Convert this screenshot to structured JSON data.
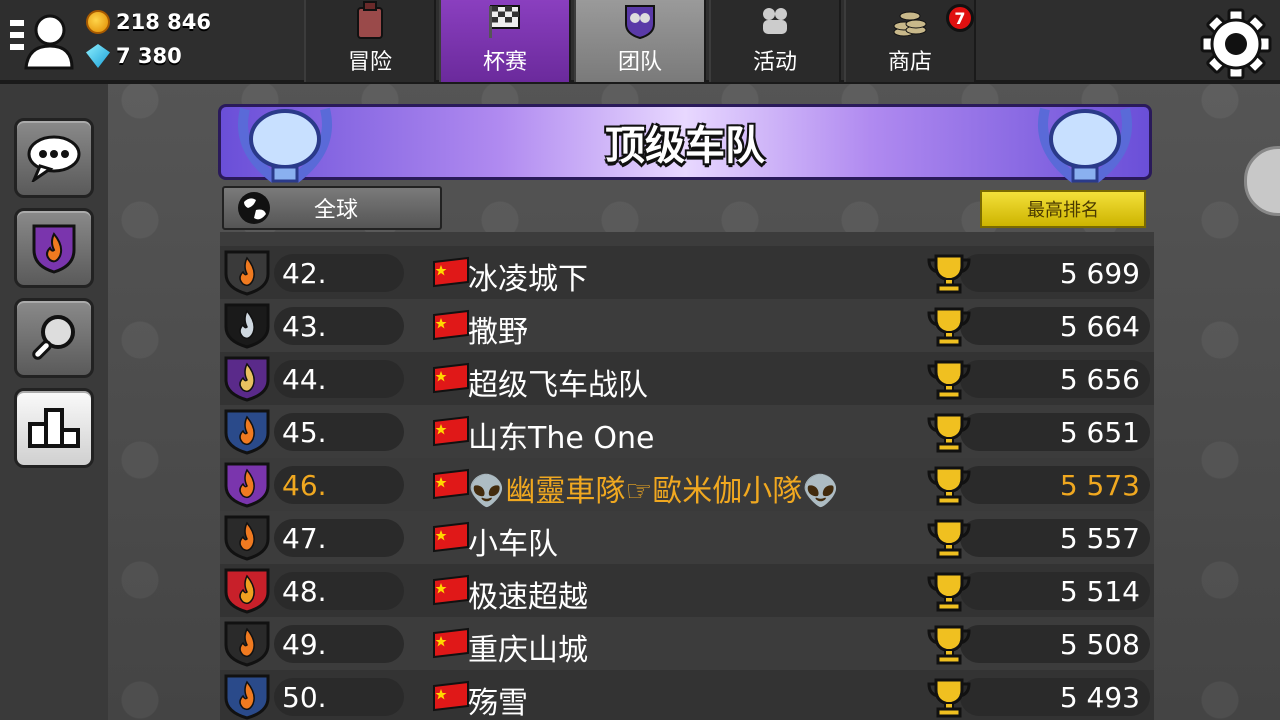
{
  "currency": {
    "coins": "218 846",
    "gems": "7 380"
  },
  "tabs": [
    {
      "label": "冒险",
      "icon": "fuel-can-icon"
    },
    {
      "label": "杯赛",
      "icon": "checkered-flag-icon"
    },
    {
      "label": "团队",
      "icon": "team-icon"
    },
    {
      "label": "活动",
      "icon": "event-icon"
    },
    {
      "label": "商店",
      "icon": "coins-stack-icon",
      "badge": "7"
    }
  ],
  "banner": {
    "title": "顶级车队"
  },
  "filters": {
    "region": "全球",
    "sort": "最高排名"
  },
  "rows": [
    {
      "rank": "42.",
      "name": "冰凌城下",
      "score": "5 699",
      "emblem": "flame-emblem-orange"
    },
    {
      "rank": "43.",
      "name": "撒野",
      "score": "5 664",
      "emblem": "deer-emblem"
    },
    {
      "rank": "44.",
      "name": "超级飞车战队",
      "score": "5 656",
      "emblem": "wings-emblem"
    },
    {
      "rank": "45.",
      "name": "山东The One",
      "score": "5 651",
      "emblem": "flame-wheel-emblem"
    },
    {
      "rank": "46.",
      "name": "👽幽靈車隊☞歐米伽小隊👽",
      "score": "5 573",
      "emblem": "flame-emblem-purple"
    },
    {
      "rank": "47.",
      "name": "小车队",
      "score": "5 557",
      "emblem": "fox-emblem"
    },
    {
      "rank": "48.",
      "name": "极速超越",
      "score": "5 514",
      "emblem": "flame-emblem-red"
    },
    {
      "rank": "49.",
      "name": "重庆山城",
      "score": "5 508",
      "emblem": "fox-emblem"
    },
    {
      "rank": "50.",
      "name": "殇雪",
      "score": "5 493",
      "emblem": "flame-wheel-emblem"
    }
  ],
  "colors": {
    "highlight": "#f0a820",
    "purple_tab": "#7a35ad",
    "rank_button": "#e6cf20"
  }
}
